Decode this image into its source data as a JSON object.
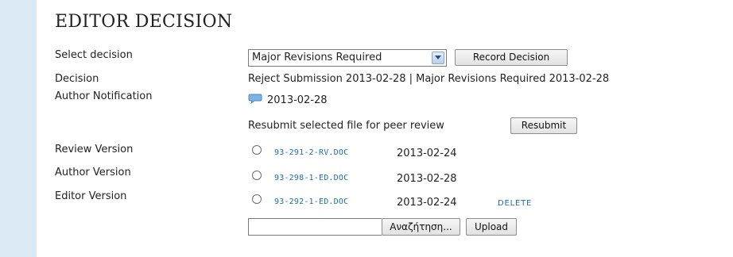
{
  "title": "EDITOR DECISION",
  "select_decision": {
    "label": "Select decision",
    "selected": "Major Revisions Required",
    "record_button": "Record Decision"
  },
  "decision": {
    "label": "Decision",
    "value": "Reject Submission  2013-02-28 | Major Revisions Required  2013-02-28"
  },
  "author_notification": {
    "label": "Author Notification",
    "icon": "speech-bubble-icon",
    "date": "2013-02-28"
  },
  "resubmit": {
    "text": "Resubmit selected file for peer review",
    "button": "Resubmit"
  },
  "versions": [
    {
      "label": "Review Version",
      "file": "93-291-2-RV.DOC",
      "date": "2013-02-24"
    },
    {
      "label": "Author Version",
      "file": "93-298-1-ED.DOC",
      "date": "2013-02-28"
    },
    {
      "label": "Editor Version",
      "file": "93-292-1-ED.DOC",
      "date": "2013-02-24",
      "action": "DELETE"
    }
  ],
  "upload": {
    "browse_button": "Αναζήτηση...",
    "upload_button": "Upload"
  },
  "colors": {
    "sidebar": "#dbe9f4",
    "link": "#1f6fa8"
  }
}
